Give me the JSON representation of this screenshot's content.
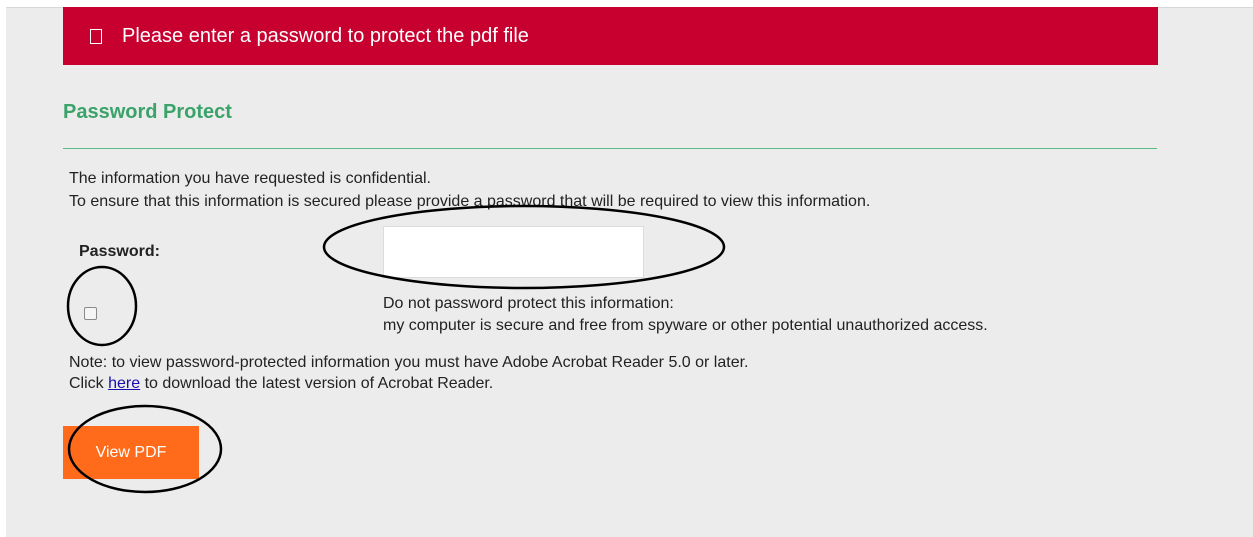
{
  "alert": {
    "icon": "square-icon",
    "message": "Please enter a password to protect the pdf file",
    "color": "#c8002f"
  },
  "section": {
    "title": "Password Protect",
    "color": "#3aa36a"
  },
  "info": {
    "line1": "The information you have requested is confidential.",
    "line2": "To ensure that this information is secured please provide a password that will be required to view this information."
  },
  "password": {
    "label": "Password:",
    "value": "",
    "placeholder": ""
  },
  "no_protect": {
    "checked": false,
    "line1": "Do not password protect this information:",
    "line2": "my computer is secure and free from spyware or other potential unauthorized access."
  },
  "note": {
    "line1": "Note: to view password-protected information you must have Adobe Acrobat Reader 5.0 or later.",
    "line2_before": "Click ",
    "link": "here",
    "line2_after": " to download the latest version of Acrobat Reader."
  },
  "button": {
    "label": "View PDF",
    "color": "#ff6b1a"
  }
}
